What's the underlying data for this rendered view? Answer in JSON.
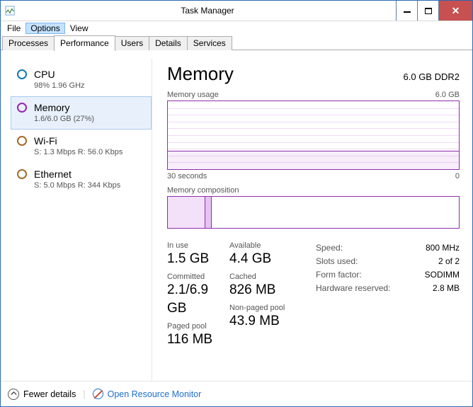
{
  "titlebar": {
    "title": "Task Manager"
  },
  "menu": {
    "file": "File",
    "options": "Options",
    "view": "View"
  },
  "tabs": {
    "processes": "Processes",
    "performance": "Performance",
    "users": "Users",
    "details": "Details",
    "services": "Services"
  },
  "sidebar": {
    "cpu": {
      "label": "CPU",
      "sub": "98%  1.96 GHz"
    },
    "memory": {
      "label": "Memory",
      "sub": "1.6/6.0 GB (27%)"
    },
    "wifi": {
      "label": "Wi-Fi",
      "sub": "S: 1.3 Mbps R: 56.0 Kbps"
    },
    "eth": {
      "label": "Ethernet",
      "sub": "S: 5.0 Mbps R: 344 Kbps"
    }
  },
  "panel": {
    "title": "Memory",
    "spec": "6.0 GB DDR2",
    "usage_label": "Memory usage",
    "usage_max": "6.0 GB",
    "axis_left": "30 seconds",
    "axis_right": "0",
    "comp_label": "Memory composition"
  },
  "stats": {
    "inuse_label": "In use",
    "inuse": "1.5 GB",
    "avail_label": "Available",
    "avail": "4.4 GB",
    "committed_label": "Committed",
    "committed": "2.1/6.9 GB",
    "cached_label": "Cached",
    "cached": "826 MB",
    "paged_label": "Paged pool",
    "paged": "116 MB",
    "nonpaged_label": "Non-paged pool",
    "nonpaged": "43.9 MB",
    "speed_k": "Speed:",
    "speed_v": "800 MHz",
    "slots_k": "Slots used:",
    "slots_v": "2 of 2",
    "form_k": "Form factor:",
    "form_v": "SODIMM",
    "hw_k": "Hardware reserved:",
    "hw_v": "2.8 MB"
  },
  "footer": {
    "fewer": "Fewer details",
    "resmon": "Open Resource Monitor"
  },
  "chart_data": {
    "type": "line",
    "title": "Memory usage",
    "ylabel": "GB",
    "ylim": [
      0,
      6.0
    ],
    "x_range_seconds": [
      30,
      0
    ],
    "series": [
      {
        "name": "Memory usage (GB)",
        "values": [
          1.6,
          1.6,
          1.6,
          1.6,
          1.6,
          1.6,
          1.55,
          1.58,
          1.6,
          1.6,
          1.6,
          1.6,
          1.6,
          1.6,
          1.6,
          1.62
        ]
      }
    ],
    "composition": {
      "in_use_gb": 1.5,
      "modified_gb": 0.2,
      "standby_free_gb": 4.3,
      "total_gb": 6.0
    }
  }
}
